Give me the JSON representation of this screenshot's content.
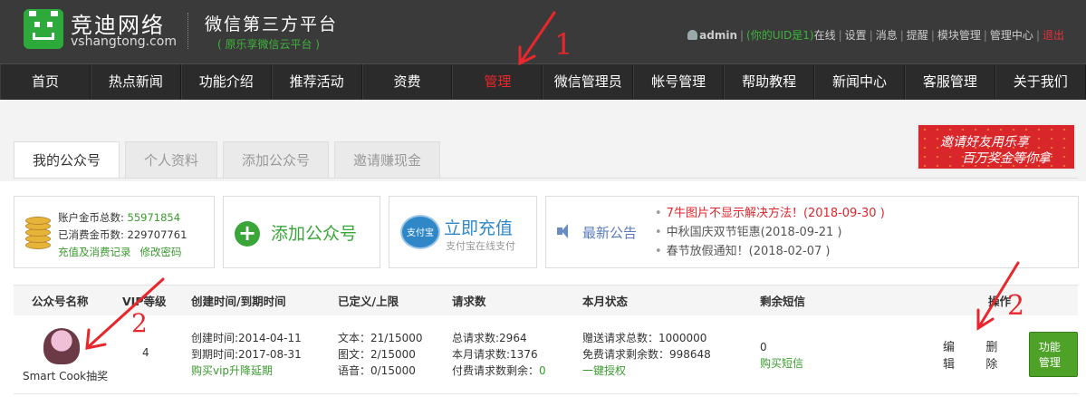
{
  "header": {
    "brand_name": "竞迪网络",
    "brand_domain": "vshangtong.com",
    "tagline": "微信第三方平台",
    "subtagline": "( 原乐享微信云平台 )",
    "user": "admin",
    "uid_text": "(你的UID是1)",
    "links": [
      "在线",
      "设置",
      "消息",
      "提醒",
      "模块管理",
      "管理中心"
    ],
    "logout": "退出"
  },
  "nav": {
    "items": [
      "首页",
      "热点新闻",
      "功能介绍",
      "推荐活动",
      "资费",
      "管理",
      "微信管理员",
      "帐号管理",
      "帮助教程",
      "新闻中心",
      "客服管理",
      "关于我们"
    ],
    "active_index": 5
  },
  "tabs": [
    "我的公众号",
    "个人资料",
    "添加公众号",
    "邀请赚现金"
  ],
  "banner": {
    "line1": "邀请好友用乐享",
    "line2": "百万奖金等你拿"
  },
  "coins": {
    "total_label": "账户金币总数:",
    "total": "55971854",
    "spent_label": "已消费金币数:",
    "spent": "229707761",
    "link_history": "充值及消费记录",
    "link_password": "修改密码"
  },
  "add_account": {
    "label": "添加公众号"
  },
  "recharge": {
    "icon_text": "支付宝",
    "title": "立即充值",
    "subtitle": "支付宝在线支付"
  },
  "news": {
    "title": "最新公告",
    "items": [
      "7牛图片不显示解决方法！(2018-09-30 )",
      "中秋国庆双节钜惠(2018-09-21 )",
      "春节放假通知！(2018-02-07 )"
    ]
  },
  "table": {
    "headers": [
      "公众号名称",
      "VIP等级",
      "创建时间/到期时间",
      "已定义/上限",
      "请求数",
      "本月状态",
      "剩余短信",
      "操作"
    ],
    "row": {
      "name": "Smart Cook抽奖",
      "vip": "4",
      "created": "创建时间:2014-04-11",
      "expires": "到期时间:2017-08-31",
      "buy_vip": "购买vip升降延期",
      "text_count": "文本：21/15000",
      "image_count": "图文：2/15000",
      "voice_count": "语音：0/15000",
      "total_requests": "总请求数:2964",
      "month_requests": "本月请求数:1376",
      "paid_remaining_label": "付费请求数剩余：",
      "paid_remaining": "0",
      "gift_requests": "赠送请求总数：1000000",
      "free_remaining": "免费请求剩余数：998648",
      "one_click_auth": "一键授权",
      "sms_count": "0",
      "buy_sms": "购买短信",
      "edit": "编辑",
      "delete": "删除",
      "func_manage": "功能管理"
    }
  },
  "annotations": [
    "1",
    "2",
    "2"
  ],
  "colors": {
    "green": "#3a9a2e",
    "red": "#e8262c",
    "header_bg": "#3a3a3a"
  }
}
